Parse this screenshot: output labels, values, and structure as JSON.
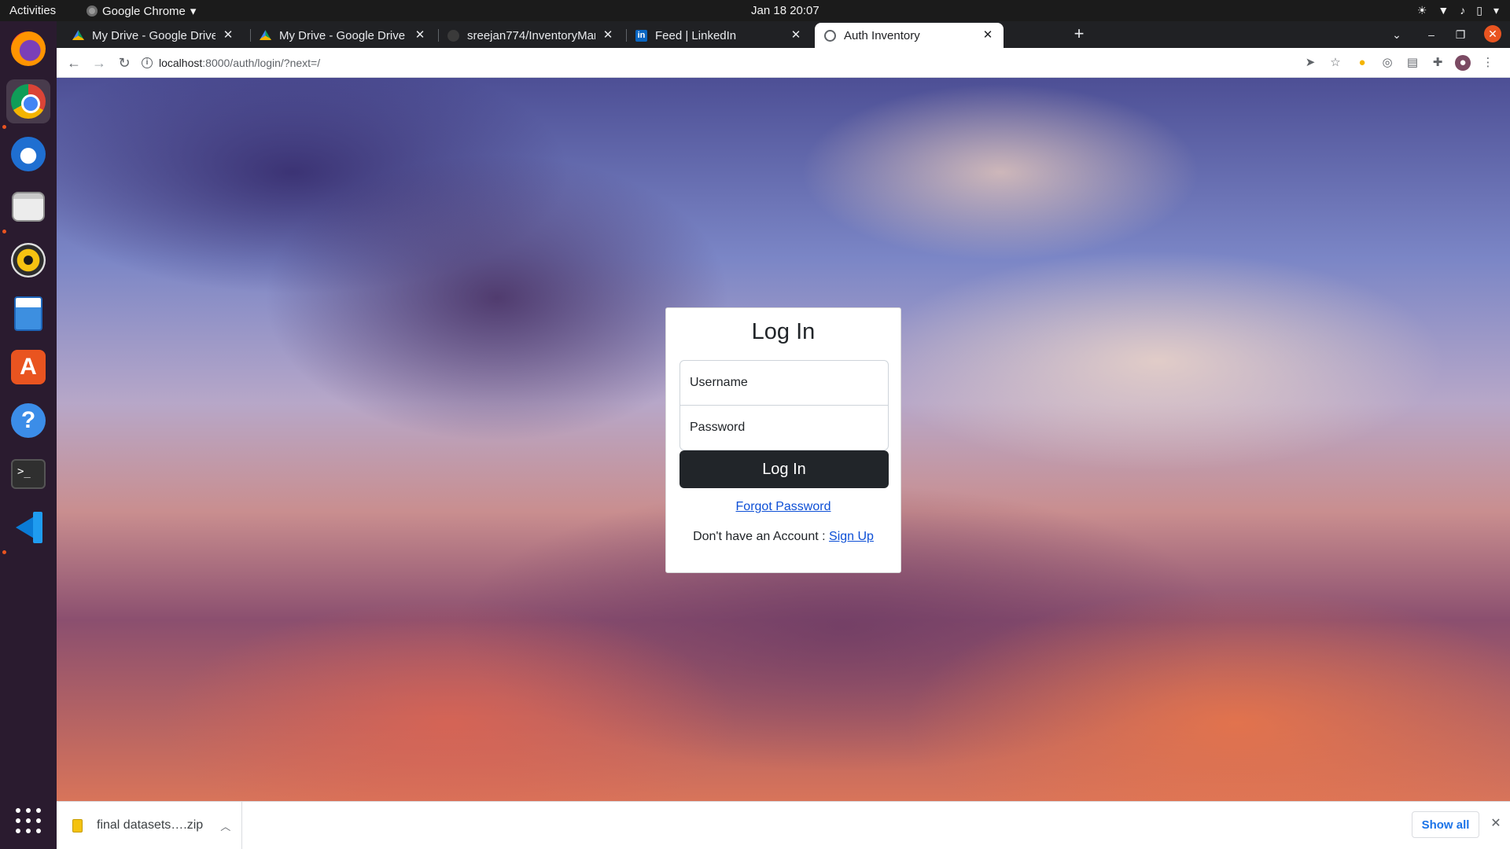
{
  "topbar": {
    "activities": "Activities",
    "app_name": "Google Chrome",
    "clock": "Jan 18  20:07"
  },
  "tabs": [
    {
      "title": "My Drive - Google Drive",
      "icon": "google-drive-icon"
    },
    {
      "title": "My Drive - Google Drive",
      "icon": "google-drive-icon"
    },
    {
      "title": "sreejan774/InventoryMan",
      "icon": "github-icon"
    },
    {
      "title": "Feed | LinkedIn",
      "icon": "linkedin-icon"
    },
    {
      "title": "Auth Inventory",
      "icon": "globe-icon",
      "active": true
    }
  ],
  "address_bar": {
    "host": "localhost",
    "path": ":8000/auth/login/?next=/"
  },
  "login": {
    "title": "Log In",
    "username_placeholder": "Username",
    "password_placeholder": "Password",
    "button_label": "Log In",
    "forgot_link": "Forgot Password",
    "signup_prompt": "Don't have an Account : ",
    "signup_link": "Sign Up"
  },
  "downloads": {
    "file_name": "final datasets….zip",
    "show_all": "Show all"
  },
  "colors": {
    "button_bg": "#212529",
    "link": "#0d4fd6",
    "ubuntu_orange": "#e95420"
  }
}
